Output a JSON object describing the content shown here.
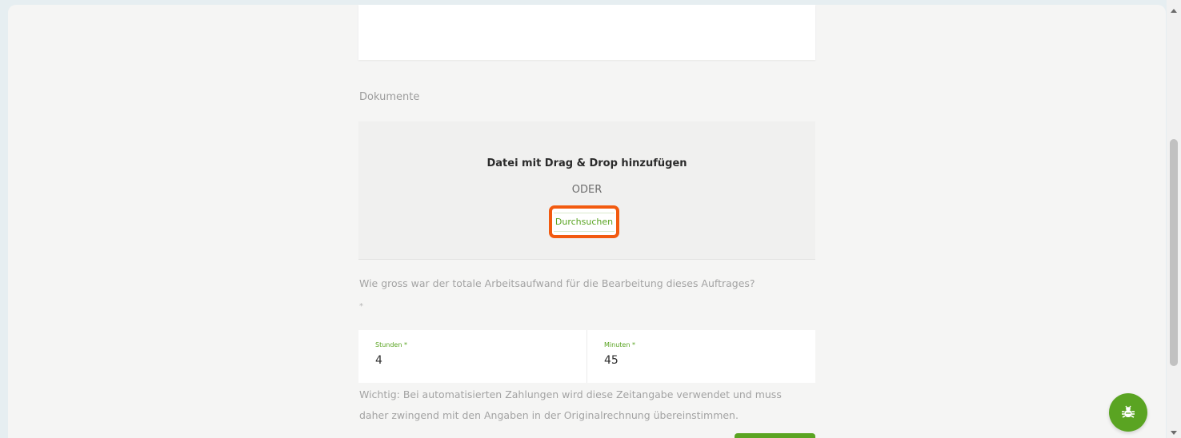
{
  "documents": {
    "section_label": "Dokumente",
    "dropzone_title": "Datei mit Drag & Drop hinzufügen",
    "or_label": "ODER",
    "browse_label": "Durchsuchen"
  },
  "effort": {
    "question": "Wie gross war der totale Arbeitsaufwand für die Bearbeitung dieses Auftrages?",
    "required_mark": "*",
    "hours": {
      "label": "Stunden *",
      "value": "4"
    },
    "minutes": {
      "label": "Minuten *",
      "value": "45"
    },
    "note": "Wichtig: Bei automatisierten Zahlungen wird diese Zeitangabe verwendet und muss daher zwingend mit den Angaben in der Originalrechnung übereinstimmen."
  },
  "colors": {
    "accent_green": "#5aa422",
    "highlight_orange": "#f25a0f"
  },
  "icons": {
    "fab": "bug-icon",
    "scroll_up": "scroll-up-arrow-icon",
    "scroll_down": "scroll-down-arrow-icon"
  }
}
